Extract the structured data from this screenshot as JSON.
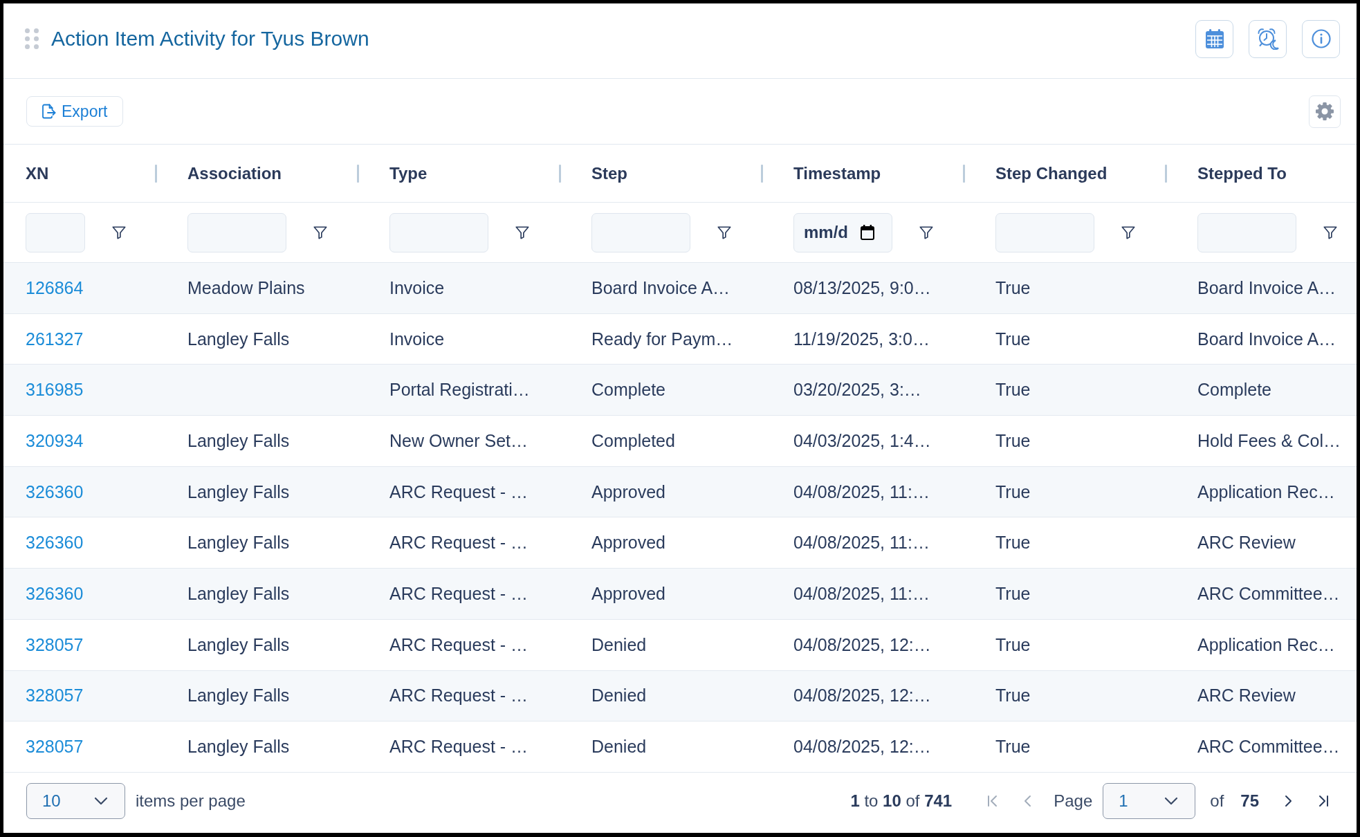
{
  "panel": {
    "title": "Action Item Activity for Tyus Brown"
  },
  "toolbar": {
    "export_label": "Export"
  },
  "table": {
    "columns": [
      {
        "label": "XN",
        "filter": {
          "kind": "text"
        }
      },
      {
        "label": "Association",
        "filter": {
          "kind": "text"
        }
      },
      {
        "label": "Type",
        "filter": {
          "kind": "text"
        }
      },
      {
        "label": "Step",
        "filter": {
          "kind": "text"
        }
      },
      {
        "label": "Timestamp",
        "filter": {
          "kind": "date",
          "placeholder": "mm/d"
        }
      },
      {
        "label": "Step Changed",
        "filter": {
          "kind": "text"
        }
      },
      {
        "label": "Stepped To",
        "filter": {
          "kind": "text"
        }
      }
    ],
    "rows": [
      {
        "xn": "126864",
        "association": "Meadow Plains",
        "type": "Invoice",
        "step": "Board Invoice A…",
        "timestamp": "08/13/2025, 9:0…",
        "step_changed": "True",
        "stepped_to": "Board Invoice A…"
      },
      {
        "xn": "261327",
        "association": "Langley Falls",
        "type": "Invoice",
        "step": "Ready for Paym…",
        "timestamp": "11/19/2025, 3:0…",
        "step_changed": "True",
        "stepped_to": "Board Invoice A…"
      },
      {
        "xn": "316985",
        "type": "Portal Registrati…",
        "step": "Complete",
        "timestamp": "03/20/2025, 3:…",
        "step_changed": "True",
        "stepped_to": "Complete"
      },
      {
        "xn": "320934",
        "association": "Langley Falls",
        "type": "New Owner Set…",
        "step": "Completed",
        "timestamp": "04/03/2025, 1:4…",
        "step_changed": "True",
        "stepped_to": "Hold Fees & Col…"
      },
      {
        "xn": "326360",
        "association": "Langley Falls",
        "type": "ARC Request - …",
        "step": "Approved",
        "timestamp": "04/08/2025, 11:…",
        "step_changed": "True",
        "stepped_to": "Application Rec…"
      },
      {
        "xn": "326360",
        "association": "Langley Falls",
        "type": "ARC Request - …",
        "step": "Approved",
        "timestamp": "04/08/2025, 11:…",
        "step_changed": "True",
        "stepped_to": "ARC Review"
      },
      {
        "xn": "326360",
        "association": "Langley Falls",
        "type": "ARC Request - …",
        "step": "Approved",
        "timestamp": "04/08/2025, 11:…",
        "step_changed": "True",
        "stepped_to": "ARC Committee…"
      },
      {
        "xn": "328057",
        "association": "Langley Falls",
        "type": "ARC Request - …",
        "step": "Denied",
        "timestamp": "04/08/2025, 12:…",
        "step_changed": "True",
        "stepped_to": "Application Rec…"
      },
      {
        "xn": "328057",
        "association": "Langley Falls",
        "type": "ARC Request - …",
        "step": "Denied",
        "timestamp": "04/08/2025, 12:…",
        "step_changed": "True",
        "stepped_to": "ARC Review"
      },
      {
        "xn": "328057",
        "association": "Langley Falls",
        "type": "ARC Request - …",
        "step": "Denied",
        "timestamp": "04/08/2025, 12:…",
        "step_changed": "True",
        "stepped_to": "ARC Committee…"
      }
    ]
  },
  "footer": {
    "page_size": "10",
    "page_size_label": "items per page",
    "range": "**1** to **10** of **741**",
    "nav_start": [
      {
        "kind": "first",
        "disabled": true
      },
      {
        "kind": "prev",
        "disabled": true
      }
    ],
    "page_label": "Page",
    "page": "1",
    "of_label": "of",
    "page_count": "75",
    "nav_end": [
      {
        "kind": "next",
        "disabled": false
      },
      {
        "kind": "last",
        "disabled": false
      }
    ]
  }
}
